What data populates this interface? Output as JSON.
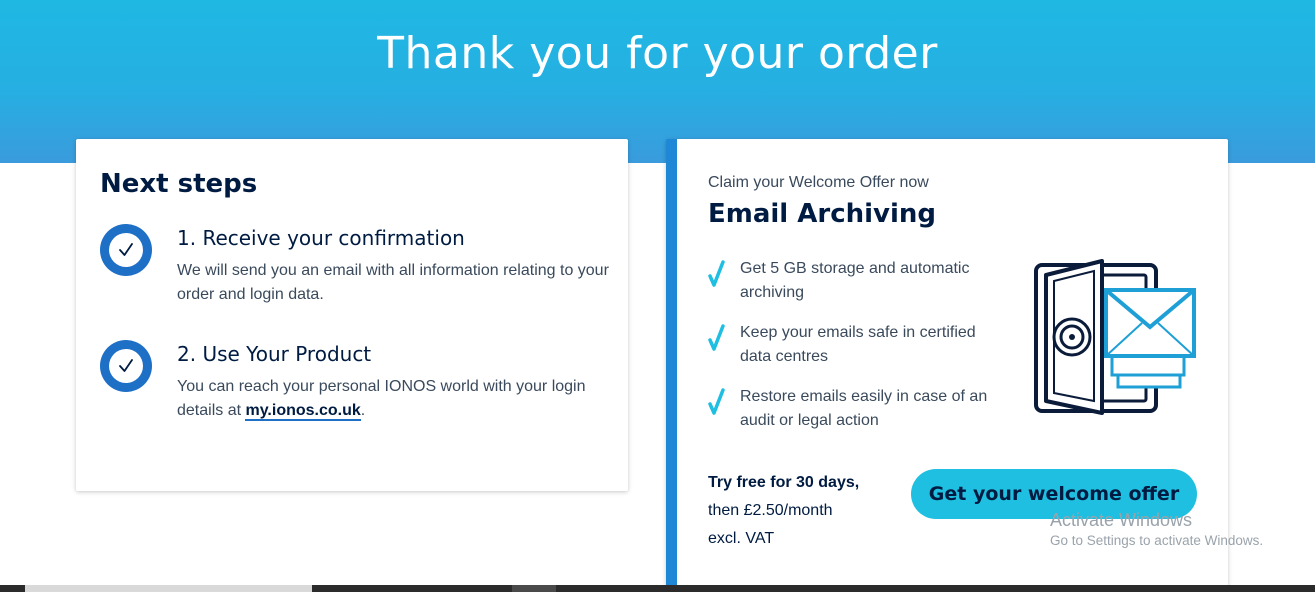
{
  "header": {
    "title": "Thank you for your order"
  },
  "next_steps": {
    "heading": "Next steps",
    "steps": [
      {
        "title": "1. Receive your confirmation",
        "text": "We will send you an email with all information relating to your order and login data."
      },
      {
        "title": "2. Use Your Product",
        "text_before": "You can reach your personal IONOS world with your login details at ",
        "link": "my.ionos.co.uk",
        "text_after": "."
      }
    ]
  },
  "offer": {
    "claim": "Claim your Welcome Offer now",
    "title": "Email Archiving",
    "features": [
      "Get 5 GB storage and automatic archiving",
      "Keep your emails safe in certified data centres",
      "Restore emails easily in case of an audit or legal action"
    ],
    "price_strong": "Try free for 30 days,",
    "price_line1": "then £2.50/month",
    "price_line2": "excl. VAT",
    "cta_label": "Get your welcome offer"
  },
  "watermark": {
    "title": "Activate Windows",
    "subtitle": "Go to Settings to activate Windows."
  },
  "colors": {
    "header": "#26afe2",
    "accent_blue": "#1e6fc6",
    "cta": "#1ebfe0",
    "text_dark": "#001b41"
  },
  "icons": {
    "step_check": "check-circle-icon",
    "feature_check": "checkmark-icon",
    "illustration": "safe-with-envelope-icon"
  }
}
